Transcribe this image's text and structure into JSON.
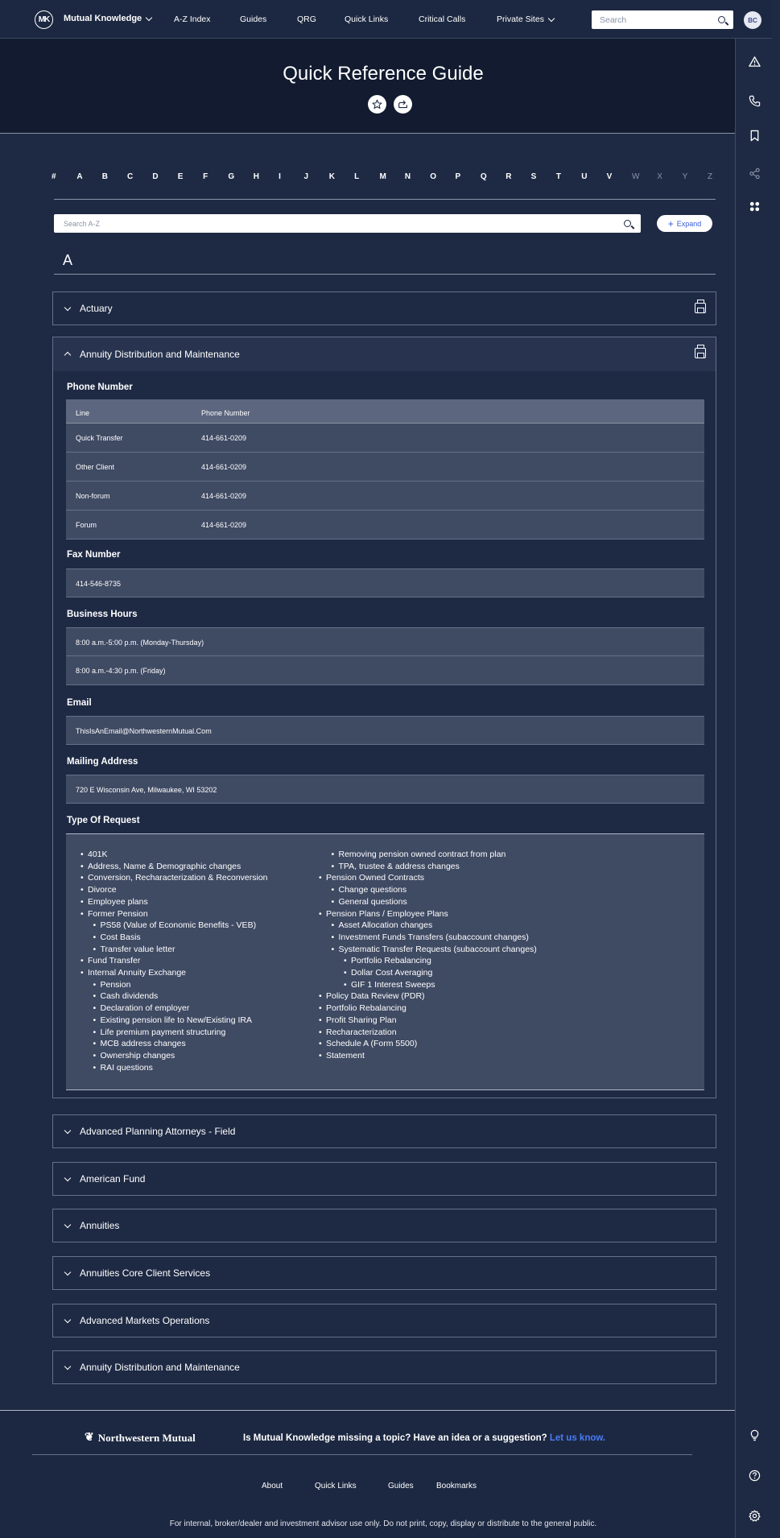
{
  "nav": {
    "logo": "MK",
    "brand": "Mutual Knowledge",
    "links": [
      "A-Z Index",
      "Guides",
      "QRG",
      "Quick Links",
      "Critical Calls",
      "Private Sites"
    ],
    "search_placeholder": "Search",
    "avatar": "BC"
  },
  "hero": {
    "title": "Quick Reference Guide"
  },
  "alphabet": {
    "letters": [
      "#",
      "A",
      "B",
      "C",
      "D",
      "E",
      "F",
      "G",
      "H",
      "I",
      "J",
      "K",
      "L",
      "M",
      "N",
      "O",
      "P",
      "Q",
      "R",
      "S",
      "T",
      "U",
      "V",
      "W",
      "X",
      "Y",
      "Z"
    ],
    "disabled": [
      "W",
      "X",
      "Y",
      "Z"
    ]
  },
  "az_search": {
    "placeholder": "Search A-Z",
    "expand_label": "Expand"
  },
  "letter_heading": "A",
  "sections": {
    "actuary": "Actuary",
    "open_title": "Annuity Distribution and Maintenance",
    "phone_title": "Phone Number",
    "phone_headers": [
      "Line",
      "Phone Number"
    ],
    "phone_rows": [
      {
        "line": "Quick Transfer",
        "phone": "414-661-0209"
      },
      {
        "line": "Other Client",
        "phone": "414-661-0209"
      },
      {
        "line": "Non-forum",
        "phone": "414-661-0209"
      },
      {
        "line": "Forum",
        "phone": "414-661-0209"
      }
    ],
    "fax_title": "Fax Number",
    "fax": "414-546-8735",
    "hours_title": "Business Hours",
    "hours": [
      "8:00 a.m.-5:00 p.m. (Monday-Thursday)",
      "8:00 a.m.-4:30 p.m. (Friday)"
    ],
    "email_title": "Email",
    "email": "ThisIsAnEmail@NorthwesternMutual.Com",
    "mail_title": "Mailing Address",
    "mail": "720 E Wisconsin Ave, Milwaukee, WI 53202",
    "request_title": "Type Of Request",
    "request_left": [
      {
        "t": "401K",
        "l": 0
      },
      {
        "t": "Address, Name & Demographic changes",
        "l": 0
      },
      {
        "t": "Conversion, Recharacterization & Reconversion",
        "l": 0
      },
      {
        "t": "Divorce",
        "l": 0
      },
      {
        "t": "Employee plans",
        "l": 0
      },
      {
        "t": "Former Pension",
        "l": 0
      },
      {
        "t": "PS58 (Value of Economic Benefits - VEB)",
        "l": 1
      },
      {
        "t": "Cost Basis",
        "l": 1
      },
      {
        "t": "Transfer value letter",
        "l": 1
      },
      {
        "t": "Fund Transfer",
        "l": 0
      },
      {
        "t": "Internal Annuity Exchange",
        "l": 0
      },
      {
        "t": "Pension",
        "l": 1
      },
      {
        "t": "Cash dividends",
        "l": 1
      },
      {
        "t": "Declaration of employer",
        "l": 1
      },
      {
        "t": "Existing pension life to New/Existing IRA",
        "l": 1
      },
      {
        "t": "Life premium payment structuring",
        "l": 1
      },
      {
        "t": "MCB address changes",
        "l": 1
      },
      {
        "t": "Ownership changes",
        "l": 1
      },
      {
        "t": "RAI questions",
        "l": 1
      }
    ],
    "request_right": [
      {
        "t": "Removing pension owned contract from plan",
        "l": 1
      },
      {
        "t": "TPA, trustee & address changes",
        "l": 1
      },
      {
        "t": "Pension Owned Contracts",
        "l": 0
      },
      {
        "t": "Change questions",
        "l": 1
      },
      {
        "t": "General questions",
        "l": 1
      },
      {
        "t": "Pension Plans / Employee Plans",
        "l": 0
      },
      {
        "t": "Asset Allocation changes",
        "l": 1
      },
      {
        "t": "Investment Funds Transfers (subaccount changes)",
        "l": 1
      },
      {
        "t": "Systematic Transfer Requests (subaccount changes)",
        "l": 1
      },
      {
        "t": "Portfolio Rebalancing",
        "l": 2
      },
      {
        "t": "Dollar Cost Averaging",
        "l": 2
      },
      {
        "t": "GIF 1 Interest Sweeps",
        "l": 2
      },
      {
        "t": "Policy Data Review (PDR)",
        "l": 0
      },
      {
        "t": "Portfolio Rebalancing",
        "l": 0
      },
      {
        "t": "Profit Sharing Plan",
        "l": 0
      },
      {
        "t": "Recharacterization",
        "l": 0
      },
      {
        "t": "Schedule A (Form 5500)",
        "l": 0
      },
      {
        "t": "Statement",
        "l": 0
      }
    ],
    "collapsed": [
      "Advanced Planning Attorneys - Field",
      "American Fund",
      "Annuities",
      "Annuities Core Client Services",
      "Advanced Markets Operations",
      "Annuity Distribution and Maintenance"
    ]
  },
  "footer": {
    "brand": "Northwestern Mutual",
    "question": "Is Mutual Knowledge missing a topic? Have an idea or a suggestion?",
    "cta": "Let us know.",
    "links": [
      "About",
      "Quick Links",
      "Guides",
      "Bookmarks"
    ],
    "disclaimer": "For internal, broker/dealer and investment advisor use only. Do not print, copy, display or distribute to the general public."
  },
  "icons": {
    "alert": "alert-triangle-icon",
    "phone": "phone-icon",
    "bookmark": "bookmark-icon",
    "share": "share-icon",
    "apps": "apps-grid-icon",
    "idea": "lightbulb-icon",
    "help": "help-icon",
    "settings": "gear-icon"
  },
  "colors": {
    "background": "#1e2a44",
    "hero": "#121b2f",
    "panel": "#3f4a63",
    "link": "#4a7cf5"
  }
}
